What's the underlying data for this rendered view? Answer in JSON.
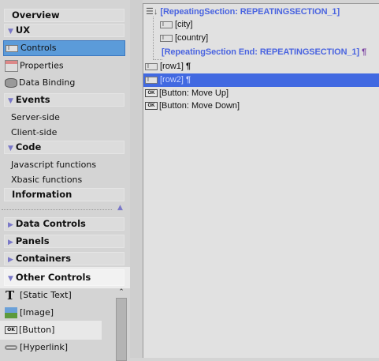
{
  "sidebar": {
    "overview": "Overview",
    "ux": "UX",
    "controls": "Controls",
    "properties": "Properties",
    "data_binding": "Data Binding",
    "events": "Events",
    "server_side": "Server-side",
    "client_side": "Client-side",
    "code": "Code",
    "javascript": "Javascript functions",
    "xbasic": "Xbasic functions",
    "information": "Information"
  },
  "palette": {
    "groups": [
      "Data Controls",
      "Panels",
      "Containers",
      "Other Controls"
    ],
    "items": [
      "[Static Text]",
      "[Image]",
      "[Button]",
      "[Hyperlink]"
    ]
  },
  "editor": {
    "rs_start": "[RepeatingSection: REPEATINGSECTION_1]",
    "city": "[city]",
    "country": "[country]",
    "rs_end": "[RepeatingSection End: REPEATINGSECTION_1]",
    "pilcrow": "¶",
    "row1": "[row1]",
    "row2": "[row2]",
    "move_up": "[Button: Move Up]",
    "move_down": "[Button: Move Down]",
    "ok_icon_text": "OK",
    "ibeam_text": "I"
  },
  "colors": {
    "selection": "#4169e1",
    "accent": "#4a64e0"
  }
}
